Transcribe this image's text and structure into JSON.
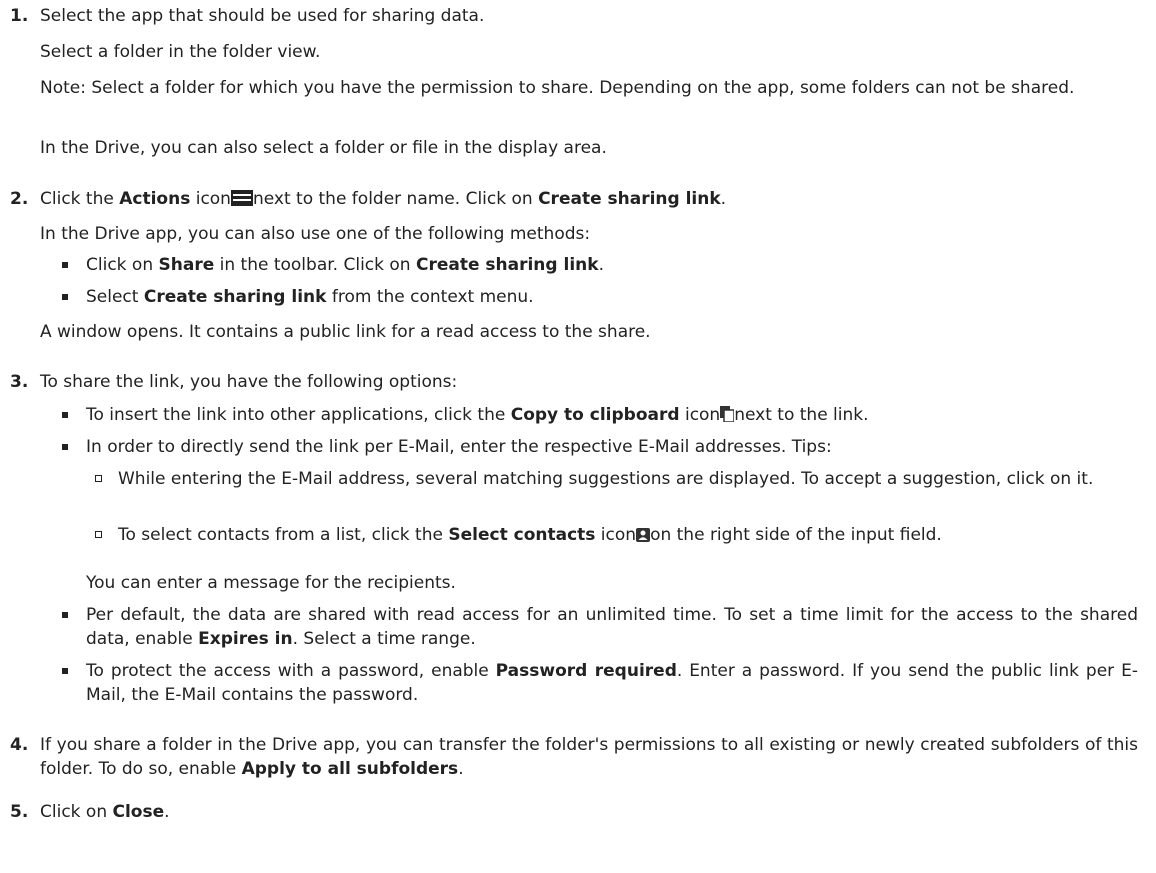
{
  "s1": {
    "num": "1.",
    "line1": "Select the app that should be used for sharing data.",
    "line2": "Select a folder in the folder view.",
    "note": "Note: Select a folder for which you have the permission to share. Depending on the app, some folders can not be shared.",
    "line4": "In the Drive, you can also select a folder or file in the display area."
  },
  "s2": {
    "num": "2.",
    "a1": "Click the ",
    "b1": "Actions",
    "a2": " icon",
    "a3": "next to the folder name. Click on ",
    "b2": "Create sharing link",
    "a4": ".",
    "methods": "In the Drive app, you can also use one of the following methods:",
    "m1a": "Click on ",
    "m1b": "Share",
    "m1c": " in the toolbar. Click on ",
    "m1d": "Create sharing link",
    "m1e": ".",
    "m2a": "Select ",
    "m2b": "Create sharing link",
    "m2c": " from the context menu.",
    "window": "A window opens. It contains a public link for a read access to the share."
  },
  "s3": {
    "num": "3.",
    "intro": "To share the link, you have the following options:",
    "o1a": "To insert the link into other applications, click the ",
    "o1b": "Copy to clipboard",
    "o1c": " icon",
    "o1d": "next to the link.",
    "o2": "In order to directly send the link per E-Mail, enter the respective E-Mail addresses. Tips:",
    "t1": "While entering the E-Mail address, several matching suggestions are displayed. To accept a suggestion, click on it.",
    "t2a": "To select contacts from a list, click the ",
    "t2b": "Select contacts",
    "t2c": " icon",
    "t2d": "on the right side of the input field.",
    "msg": "You can enter a message for the recipients.",
    "o3a": "Per default, the data are shared with read access for an unlimited time. To set a time limit for the access to the shared data, enable ",
    "o3b": "Expires in",
    "o3c": ". Select a time range.",
    "o4a": "To protect the access with a password, enable ",
    "o4b": "Password required",
    "o4c": ". Enter a password. If you send the public link per E-Mail, the E-Mail contains the password."
  },
  "s4": {
    "num": "4.",
    "a": "If you share a folder in the Drive app, you can transfer the folder's permissions to all existing or newly created subfolders of this folder. To do so, enable ",
    "b": "Apply to all subfolders",
    "c": "."
  },
  "s5": {
    "num": "5.",
    "a": "Click on ",
    "b": "Close",
    "c": "."
  },
  "icons": [
    "actions-icon",
    "copy-icon",
    "contacts-icon"
  ]
}
